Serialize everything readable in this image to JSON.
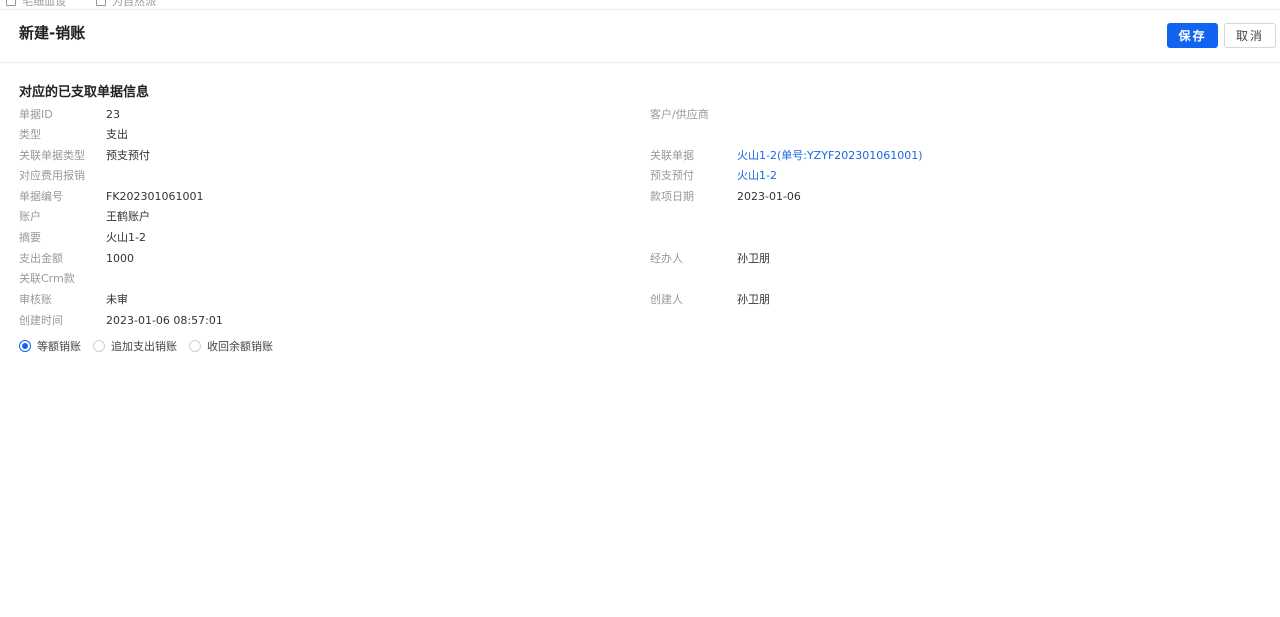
{
  "top_strip": {
    "item1": "毛细血设",
    "item2": "为自然派"
  },
  "header": {
    "title": "新建-销账",
    "save_label": "保存",
    "cancel_label": "取消"
  },
  "section": {
    "title": "对应的已支取单据信息"
  },
  "fields": {
    "doc_id": {
      "label": "单据ID",
      "value": "23"
    },
    "customer": {
      "label": "客户/供应商",
      "value": ""
    },
    "type": {
      "label": "类型",
      "value": "支出"
    },
    "linked_doc_type": {
      "label": "关联单据类型",
      "value": "预支预付"
    },
    "linked_doc": {
      "label": "关联单据",
      "value": "火山1-2(单号:YZYF202301061001)"
    },
    "expense_claim": {
      "label": "对应费用报销",
      "value": ""
    },
    "prepay": {
      "label": "预支预付",
      "value": "火山1-2"
    },
    "doc_no": {
      "label": "单据编号",
      "value": "FK202301061001"
    },
    "payment_date": {
      "label": "款项日期",
      "value": "2023-01-06"
    },
    "account": {
      "label": "账户",
      "value": "王鹤账户"
    },
    "summary": {
      "label": "摘要",
      "value": "火山1-2"
    },
    "amount": {
      "label": "支出金额",
      "value": "1000"
    },
    "handler": {
      "label": "经办人",
      "value": "孙卫朋"
    },
    "crm": {
      "label": "关联Crm款",
      "value": ""
    },
    "audit": {
      "label": "审核账",
      "value": "未审"
    },
    "creator": {
      "label": "创建人",
      "value": "孙卫朋"
    },
    "created_time": {
      "label": "创建时间",
      "value": "2023-01-06 08:57:01"
    }
  },
  "radio_options": {
    "equal": "等额销账",
    "add": "追加支出销账",
    "recover": "收回余额销账",
    "selected": "等额销账"
  },
  "colors": {
    "primary": "#1164f0",
    "link": "#1a66e6",
    "label": "#999999"
  }
}
